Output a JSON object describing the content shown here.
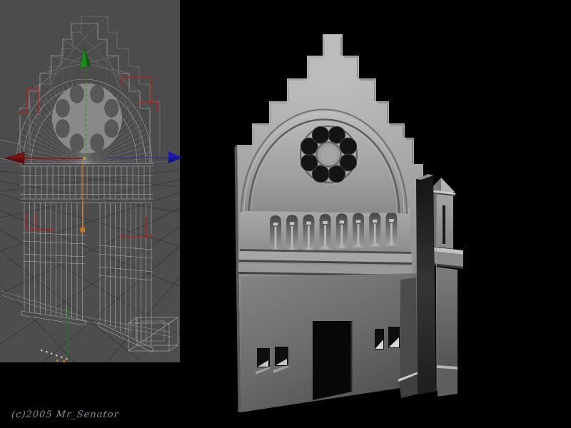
{
  "watermark": {
    "text": "(c)2005 Mr_Senator",
    "color": "#99a0ab"
  },
  "viewport": {
    "background_color": "#4c4c4c",
    "wireframe_color": "#b3b3b3",
    "selection_color": "#b62020",
    "grid_line_color": "#3a3a3a",
    "horizon_line_color": "#596078",
    "rose_hole_count": 8,
    "gizmo": {
      "x_axis_color": "#8b1515",
      "y_axis_color": "#2e8b2e",
      "z_axis_color": "#1a1ab2",
      "screen_axis_color": "#c87820",
      "origin_axis_color": "#1e7a1e"
    }
  },
  "render": {
    "background_color": "#000000",
    "model_base_color": "#9a9a9a",
    "gable_step_count": 6,
    "arcade_niche_count": 8,
    "rose_hole_count": 8,
    "left_window_count": 2,
    "right_window_count": 2,
    "door_count": 1
  }
}
